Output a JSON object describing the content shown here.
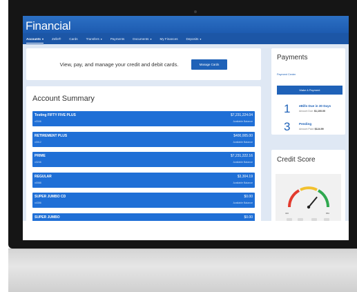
{
  "app": {
    "brand": "Financial"
  },
  "nav": [
    {
      "label": "Accounts",
      "caret": true,
      "active": true
    },
    {
      "label": "Zelle®",
      "caret": false
    },
    {
      "label": "Cards",
      "caret": false
    },
    {
      "label": "Transfers",
      "caret": true
    },
    {
      "label": "Payments",
      "caret": false
    },
    {
      "label": "Documents",
      "caret": true
    },
    {
      "label": "My Finances",
      "caret": false
    },
    {
      "label": "Deposits",
      "caret": true
    }
  ],
  "intro": {
    "text": "View, pay, and manage your credit and debit cards.",
    "button": "Manage Cards"
  },
  "summary": {
    "title": "Account Summary",
    "accounts": [
      {
        "name": "Testing FIFTY FIVE PLUS",
        "number": "x3346",
        "balance": "$7,231,224.04",
        "balance_label": "Available Balance"
      },
      {
        "name": "RETIREMENT PLUS",
        "number": "x3012",
        "balance": "$400,005.00",
        "balance_label": "Available Balance"
      },
      {
        "name": "PRIME",
        "number": "x3246",
        "balance": "$7,231,222.16",
        "balance_label": "Available Balance"
      },
      {
        "name": "REGULAR",
        "number": "x0088",
        "balance": "$3,304.19",
        "balance_label": "Available Balance"
      },
      {
        "name": "SUPER JUMBO CD",
        "number": "x4356",
        "balance": "$0.00",
        "balance_label": "Available Balance"
      },
      {
        "name": "SUPER JUMBO",
        "number": "",
        "balance": "$0.00",
        "balance_label": ""
      }
    ]
  },
  "payments": {
    "title": "Payments",
    "link": "Payment Center",
    "button": "Make A Payment",
    "rows": [
      {
        "count": "1",
        "title": "eBills Due in 30 Days",
        "sub_label": "Amount Due:",
        "sub_value": "$1,100.00"
      },
      {
        "count": "3",
        "title": "Pending",
        "sub_label": "Amount Paid:",
        "sub_value": "$124.99"
      }
    ]
  },
  "credit": {
    "title": "Credit Score",
    "gauge_min": "300",
    "gauge_max": "850",
    "score_fraction": 0.72,
    "colors": {
      "low": "#e23b2e",
      "mid": "#f2c12e",
      "high": "#2fa84f"
    }
  },
  "colors": {
    "accent": "#1f62b8",
    "account_row": "#1f6fd6",
    "nav": "#1c56a6",
    "page_bg": "#dfe8f4"
  }
}
